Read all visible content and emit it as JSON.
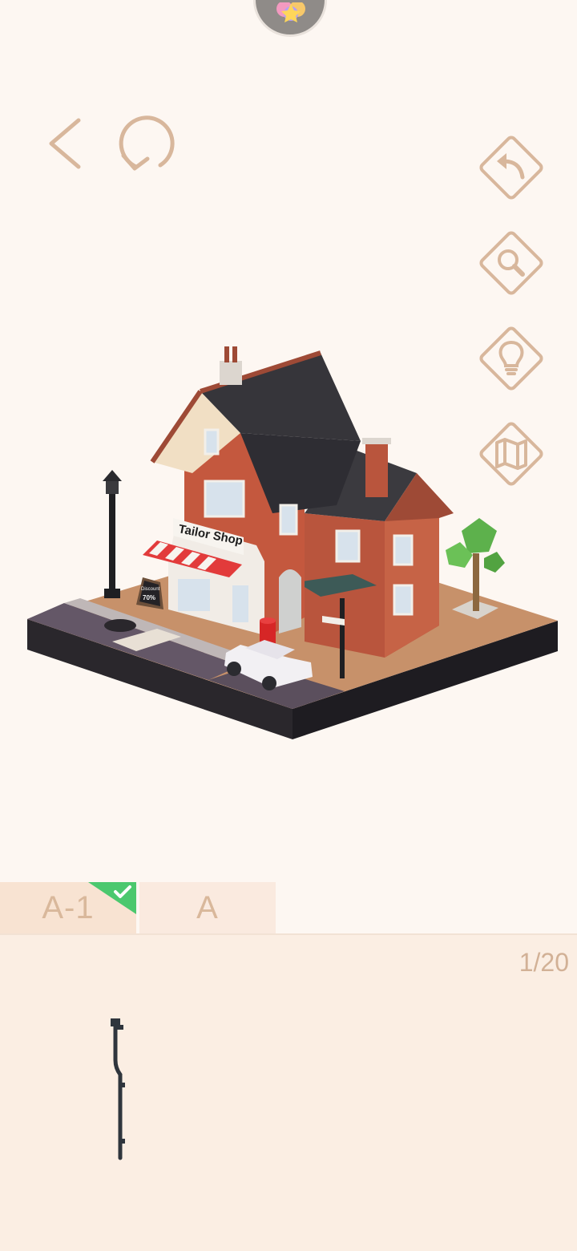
{
  "header": {
    "back_icon": "chevron-left-icon",
    "restart_icon": "restart-icon",
    "badge_icon": "star-flower-icon"
  },
  "toolbar": {
    "undo_icon": "undo-arrow-icon",
    "zoom_icon": "magnifier-icon",
    "hint_icon": "lightbulb-icon",
    "map_icon": "map-icon"
  },
  "scene": {
    "shop_sign": "Tailor Shop",
    "board_text_1": "Discount",
    "board_text_2": "70%"
  },
  "tabs": [
    {
      "label": "A-1",
      "completed": true
    },
    {
      "label": "A",
      "completed": false
    }
  ],
  "tray": {
    "counter": "1/20",
    "piece_icon": "lamp-post-piece-icon"
  },
  "colors": {
    "accent": "#d9b89b",
    "background": "#fdf7f2",
    "tray": "#fbeee3",
    "check_green": "#4bc86e",
    "icon_stroke": "#d8b79c"
  }
}
